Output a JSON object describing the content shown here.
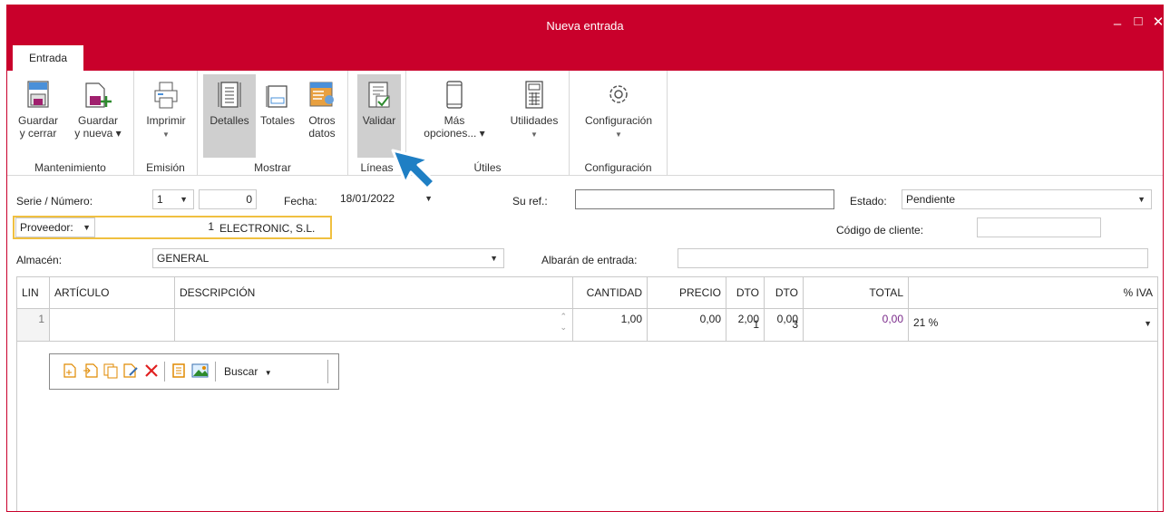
{
  "window": {
    "title": "Nueva entrada",
    "minimize": "–",
    "maximize": "□",
    "close": "✕"
  },
  "tabs": {
    "active": "Entrada"
  },
  "ribbon": {
    "groups": {
      "mantenimiento": "Mantenimiento",
      "emision": "Emisión",
      "mostrar": "Mostrar",
      "lineas": "Líneas",
      "utiles": "Útiles",
      "configuracion": "Configuración"
    },
    "buttons": {
      "guardar_cerrar": "Guardar\ny cerrar",
      "guardar_nueva": "Guardar\ny nueva ▾",
      "imprimir": "Imprimir",
      "detalles": "Detalles",
      "totales": "Totales",
      "otros_datos": "Otros\ndatos",
      "validar": "Validar",
      "mas_opciones": "Más\nopciones... ▾",
      "utilidades": "Utilidades",
      "configuracion": "Configuración"
    },
    "accent_color": "#c9002b"
  },
  "form": {
    "serie_label": "Serie / Número:",
    "serie_value": "1",
    "numero_value": "0",
    "fecha_label": "Fecha:",
    "fecha_value": "18/01/2022",
    "suref_label": "Su ref.:",
    "suref_value": "",
    "estado_label": "Estado:",
    "estado_value": "Pendiente",
    "proveedor_label": "Proveedor:",
    "proveedor_code": "1",
    "proveedor_name": "ELECTRONIC, S.L.",
    "codigo_cliente_label": "Código de cliente:",
    "codigo_cliente_value": "",
    "almacen_label": "Almacén:",
    "almacen_value": "GENERAL",
    "albaran_label": "Albarán de entrada:",
    "albaran_value": ""
  },
  "grid": {
    "columns": {
      "lin": "LIN",
      "articulo": "ARTÍCULO",
      "descripcion": "DESCRIPCIÓN",
      "cantidad": "CANTIDAD",
      "precio": "PRECIO",
      "dto1": "DTO 1",
      "dto3": "DTO 3",
      "total": "TOTAL",
      "iva": "% IVA"
    },
    "rows": [
      {
        "lin": "1",
        "articulo": "",
        "descripcion": "",
        "cantidad": "1,00",
        "precio": "0,00",
        "dto1": "2,00",
        "dto3": "0,00",
        "total": "0,00",
        "iva": "21 %"
      }
    ]
  },
  "line_toolbar": {
    "buscar": "Buscar"
  }
}
